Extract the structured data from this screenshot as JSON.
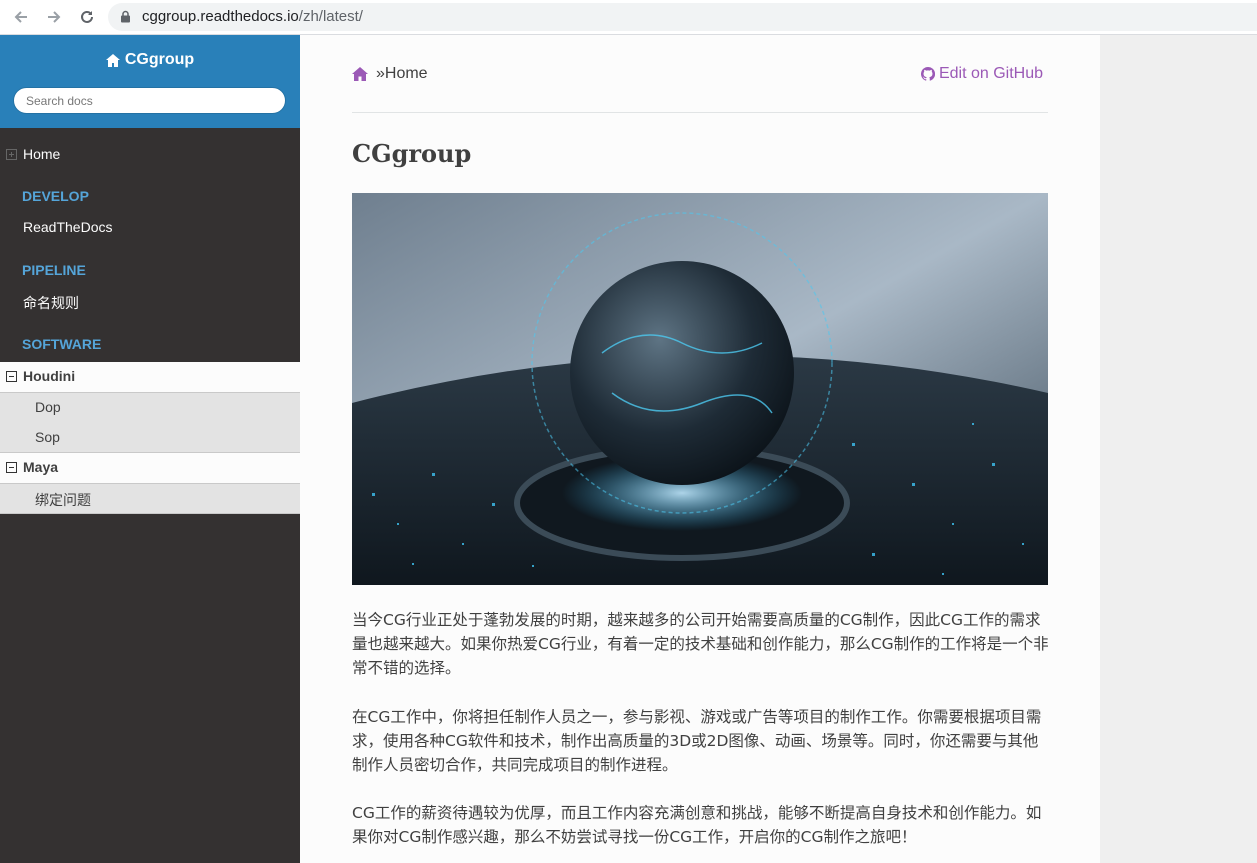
{
  "browser": {
    "url_host": "cggroup.readthedocs.io",
    "url_path": "/zh/latest/"
  },
  "sidebar": {
    "brand": "CGgroup",
    "search_placeholder": "Search docs",
    "home_label": "Home",
    "captions": [
      "DEVELOP",
      "PIPELINE",
      "SOFTWARE"
    ],
    "develop_items": [
      "ReadTheDocs"
    ],
    "pipeline_items": [
      "命名规则"
    ],
    "software": [
      {
        "label": "Houdini",
        "children": [
          "Dop",
          "Sop"
        ]
      },
      {
        "label": "Maya",
        "children": [
          "绑定问题"
        ]
      }
    ]
  },
  "content": {
    "breadcrumb_current": "»Home",
    "edit_link": "Edit on GitHub",
    "title": "CGgroup",
    "paragraphs": [
      "当今CG行业正处于蓬勃发展的时期，越来越多的公司开始需要高质量的CG制作，因此CG工作的需求量也越来越大。如果你热爱CG行业，有着一定的技术基础和创作能力，那么CG制作的工作将是一个非常不错的选择。",
      "在CG工作中，你将担任制作人员之一，参与影视、游戏或广告等项目的制作工作。你需要根据项目需求，使用各种CG软件和技术，制作出高质量的3D或2D图像、动画、场景等。同时，你还需要与其他制作人员密切合作，共同完成项目的制作进程。",
      "CG工作的薪资待遇较为优厚，而且工作内容充满创意和挑战，能够不断提高自身技术和创作能力。如果你对CG制作感兴趣，那么不妨尝试寻找一份CG工作，开启你的CG制作之旅吧！"
    ]
  },
  "colors": {
    "sidebar_bg": "#343131",
    "sidebar_header": "#2980b9",
    "caption": "#55a5d9",
    "link_purple": "#9b59b6"
  }
}
